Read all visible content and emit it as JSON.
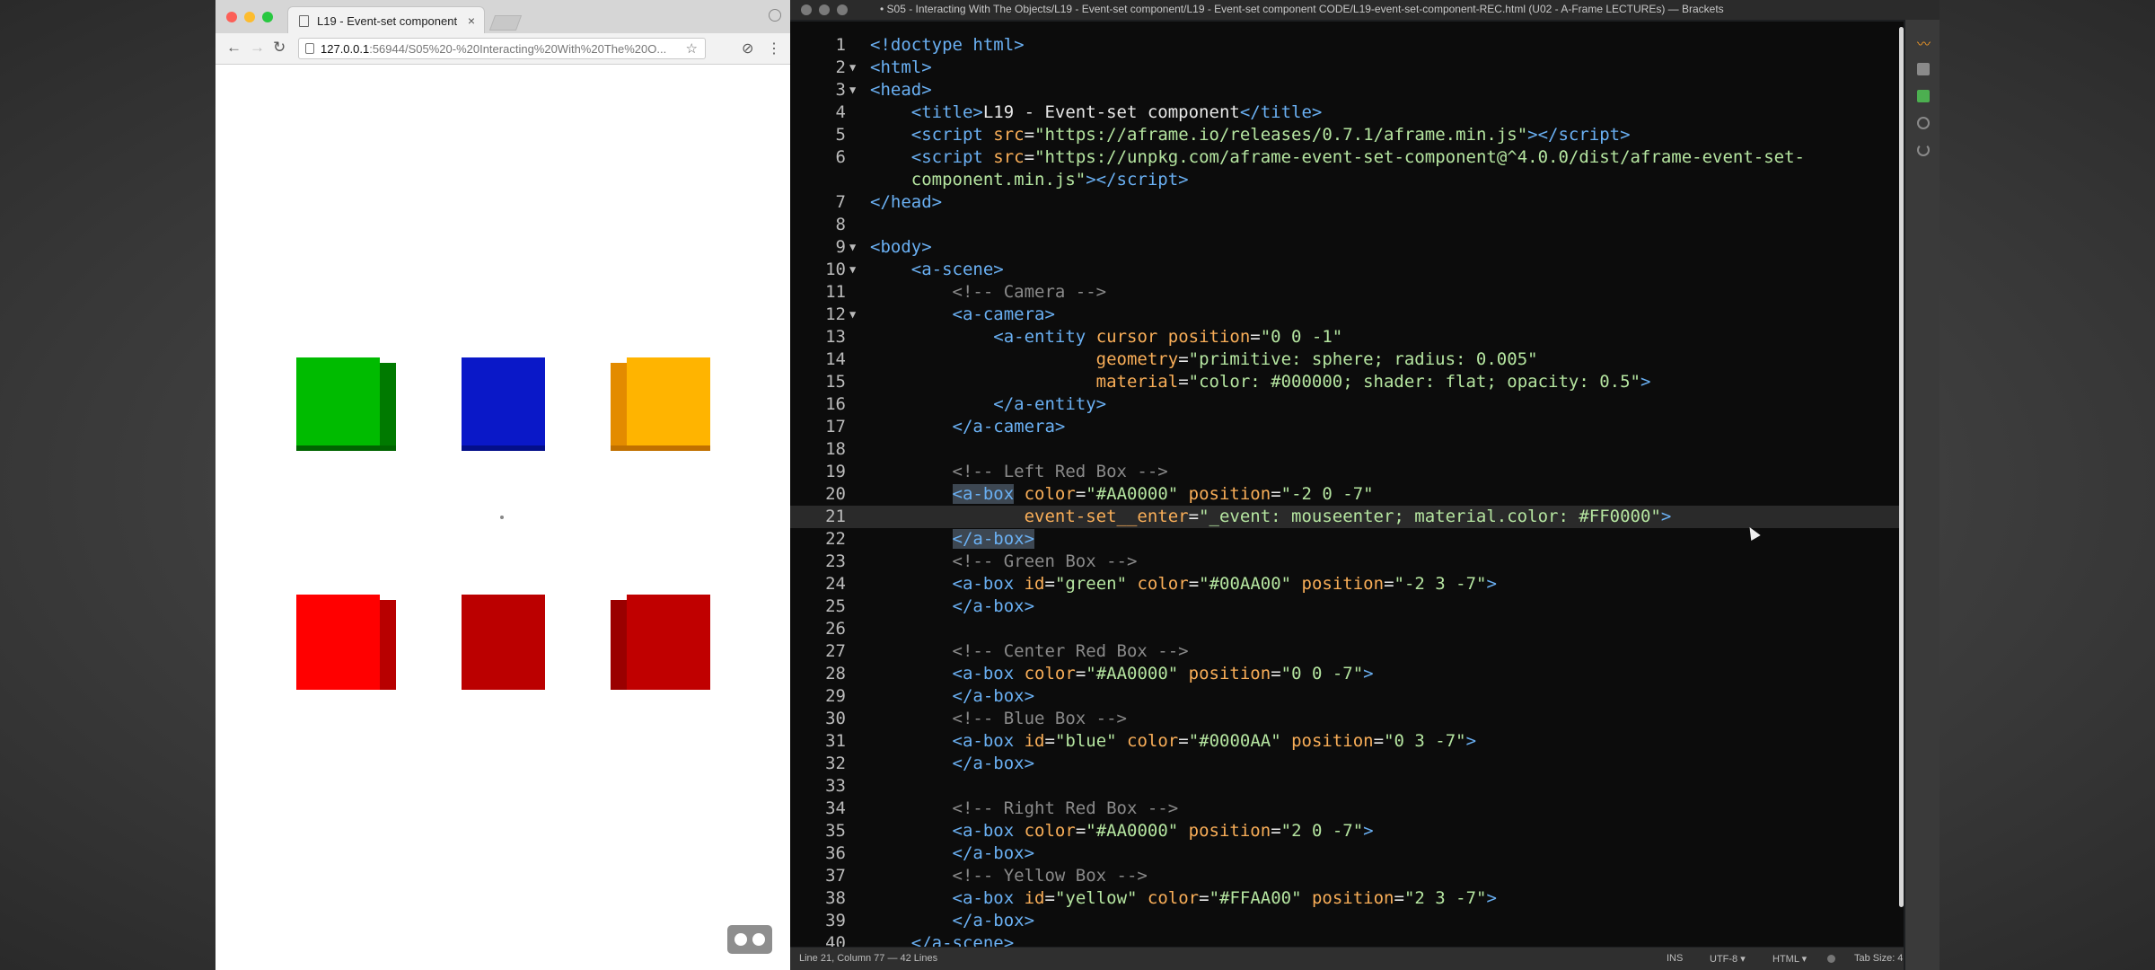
{
  "browser": {
    "tab_title": "L19 - Event-set component",
    "tab_close": "×",
    "url_host": "127.0.0.1",
    "url_rest": ":56944/S05%20-%20Interacting%20With%20The%20O...",
    "nav_back": "←",
    "nav_forward": "→",
    "nav_reload": "↻",
    "bookmark_star": "☆",
    "menu_dots": "⋮",
    "scene": {
      "boxes": [
        {
          "name": "green-box",
          "color": "#00AA00"
        },
        {
          "name": "blue-box",
          "color": "#0000AA"
        },
        {
          "name": "yellow-box",
          "color": "#FFAA00"
        },
        {
          "name": "left-red-box",
          "color": "#FF0000"
        },
        {
          "name": "center-red-box",
          "color": "#AA0000"
        },
        {
          "name": "right-red-box",
          "color": "#AA0000"
        }
      ]
    }
  },
  "editor": {
    "title": "• S05 - Interacting With The Objects/L19 - Event-set component/L19 - Event-set component CODE/L19-event-set-component-REC.html (U02 - A-Frame LECTUREs) — Brackets",
    "lines": [
      {
        "n": "1",
        "fold": "",
        "html": "<span class='tag'>&lt;!doctype html&gt;</span>"
      },
      {
        "n": "2",
        "fold": "▼",
        "html": "<span class='tag'>&lt;html&gt;</span>"
      },
      {
        "n": "3",
        "fold": "▼",
        "html": "<span class='tag'>&lt;head&gt;</span>"
      },
      {
        "n": "4",
        "fold": "",
        "html": "    <span class='tag'>&lt;title&gt;</span><span class='pl'>L19 - Event-set component</span><span class='tag'>&lt;/title&gt;</span>"
      },
      {
        "n": "5",
        "fold": "",
        "html": "    <span class='tag'>&lt;script</span> <span class='attr'>src</span><span class='pl'>=</span><span class='val'>\"https://aframe.io/releases/0.7.1/aframe.min.js\"</span><span class='tag'>&gt;&lt;/script&gt;</span>"
      },
      {
        "n": "6",
        "fold": "",
        "html": "    <span class='tag'>&lt;script</span> <span class='attr'>src</span><span class='pl'>=</span><span class='val'>\"https://unpkg.com/aframe-event-set-component@^4.0.0/dist/aframe-event-set-</span>"
      },
      {
        "n": "",
        "fold": "",
        "html": "    <span class='val'>component.min.js\"</span><span class='tag'>&gt;&lt;/script&gt;</span>"
      },
      {
        "n": "7",
        "fold": "",
        "html": "<span class='tag'>&lt;/head&gt;</span>"
      },
      {
        "n": "8",
        "fold": "",
        "html": ""
      },
      {
        "n": "9",
        "fold": "▼",
        "html": "<span class='tag'>&lt;body&gt;</span>"
      },
      {
        "n": "10",
        "fold": "▼",
        "html": "    <span class='tag'>&lt;a-scene&gt;</span>"
      },
      {
        "n": "11",
        "fold": "",
        "html": "        <span class='cm'>&lt;!-- Camera --&gt;</span>"
      },
      {
        "n": "12",
        "fold": "▼",
        "html": "        <span class='tag'>&lt;a-camera&gt;</span>"
      },
      {
        "n": "13",
        "fold": "",
        "html": "            <span class='tag'>&lt;a-entity</span> <span class='attr'>cursor position</span><span class='pl'>=</span><span class='val'>\"0 0 -1\"</span>"
      },
      {
        "n": "14",
        "fold": "",
        "html": "                      <span class='attr'>geometry</span><span class='pl'>=</span><span class='val'>\"primitive: sphere; radius: 0.005\"</span>"
      },
      {
        "n": "15",
        "fold": "",
        "html": "                      <span class='attr'>material</span><span class='pl'>=</span><span class='val'>\"color: #000000; shader: flat; opacity: 0.5\"</span><span class='tag'>&gt;</span>"
      },
      {
        "n": "16",
        "fold": "",
        "html": "            <span class='tag'>&lt;/a-entity&gt;</span>"
      },
      {
        "n": "17",
        "fold": "",
        "html": "        <span class='tag'>&lt;/a-camera&gt;</span>"
      },
      {
        "n": "18",
        "fold": "",
        "html": ""
      },
      {
        "n": "19",
        "fold": "",
        "html": "        <span class='cm'>&lt;!-- Left Red Box --&gt;</span>"
      },
      {
        "n": "20",
        "fold": "",
        "html": "        <span class='tag sel'>&lt;a-box</span> <span class='attr'>color</span><span class='pl'>=</span><span class='val'>\"#AA0000\"</span> <span class='attr'>position</span><span class='pl'>=</span><span class='val'>\"-2 0 -7\"</span>"
      },
      {
        "n": "21",
        "fold": "",
        "html": "               <span class='attr'>event-set__enter</span><span class='pl'>=</span><span class='val'>\"_event: mouseenter; material.color: #FF0000\"</span><span class='tag'>&gt;</span>",
        "active": true
      },
      {
        "n": "22",
        "fold": "",
        "html": "        <span class='tag sel'>&lt;/a-box&gt;</span>"
      },
      {
        "n": "23",
        "fold": "",
        "html": "        <span class='cm'>&lt;!-- Green Box --&gt;</span>"
      },
      {
        "n": "24",
        "fold": "",
        "html": "        <span class='tag'>&lt;a-box</span> <span class='attr'>id</span><span class='pl'>=</span><span class='val'>\"green\"</span> <span class='attr'>color</span><span class='pl'>=</span><span class='val'>\"#00AA00\"</span> <span class='attr'>position</span><span class='pl'>=</span><span class='val'>\"-2 3 -7\"</span><span class='tag'>&gt;</span>"
      },
      {
        "n": "25",
        "fold": "",
        "html": "        <span class='tag'>&lt;/a-box&gt;</span>"
      },
      {
        "n": "26",
        "fold": "",
        "html": ""
      },
      {
        "n": "27",
        "fold": "",
        "html": "        <span class='cm'>&lt;!-- Center Red Box --&gt;</span>"
      },
      {
        "n": "28",
        "fold": "",
        "html": "        <span class='tag'>&lt;a-box</span> <span class='attr'>color</span><span class='pl'>=</span><span class='val'>\"#AA0000\"</span> <span class='attr'>position</span><span class='pl'>=</span><span class='val'>\"0 0 -7\"</span><span class='tag'>&gt;</span>"
      },
      {
        "n": "29",
        "fold": "",
        "html": "        <span class='tag'>&lt;/a-box&gt;</span>"
      },
      {
        "n": "30",
        "fold": "",
        "html": "        <span class='cm'>&lt;!-- Blue Box --&gt;</span>"
      },
      {
        "n": "31",
        "fold": "",
        "html": "        <span class='tag'>&lt;a-box</span> <span class='attr'>id</span><span class='pl'>=</span><span class='val'>\"blue\"</span> <span class='attr'>color</span><span class='pl'>=</span><span class='val'>\"#0000AA\"</span> <span class='attr'>position</span><span class='pl'>=</span><span class='val'>\"0 3 -7\"</span><span class='tag'>&gt;</span>"
      },
      {
        "n": "32",
        "fold": "",
        "html": "        <span class='tag'>&lt;/a-box&gt;</span>"
      },
      {
        "n": "33",
        "fold": "",
        "html": ""
      },
      {
        "n": "34",
        "fold": "",
        "html": "        <span class='cm'>&lt;!-- Right Red Box --&gt;</span>"
      },
      {
        "n": "35",
        "fold": "",
        "html": "        <span class='tag'>&lt;a-box</span> <span class='attr'>color</span><span class='pl'>=</span><span class='val'>\"#AA0000\"</span> <span class='attr'>position</span><span class='pl'>=</span><span class='val'>\"2 0 -7\"</span><span class='tag'>&gt;</span>"
      },
      {
        "n": "36",
        "fold": "",
        "html": "        <span class='tag'>&lt;/a-box&gt;</span>"
      },
      {
        "n": "37",
        "fold": "",
        "html": "        <span class='cm'>&lt;!-- Yellow Box --&gt;</span>"
      },
      {
        "n": "38",
        "fold": "",
        "html": "        <span class='tag'>&lt;a-box</span> <span class='attr'>id</span><span class='pl'>=</span><span class='val'>\"yellow\"</span> <span class='attr'>color</span><span class='pl'>=</span><span class='val'>\"#FFAA00\"</span> <span class='attr'>position</span><span class='pl'>=</span><span class='val'>\"2 3 -7\"</span><span class='tag'>&gt;</span>"
      },
      {
        "n": "39",
        "fold": "",
        "html": "        <span class='tag'>&lt;/a-box&gt;</span>"
      },
      {
        "n": "40",
        "fold": "",
        "html": "    <span class='tag'>&lt;/a-scene&gt;</span>"
      }
    ],
    "status": {
      "position": "Line 21, Column 77 — 42 Lines",
      "mode": "INS",
      "encoding": "UTF-8 ▾",
      "language": "HTML ▾",
      "tab_size": "Tab Size: 4"
    }
  }
}
